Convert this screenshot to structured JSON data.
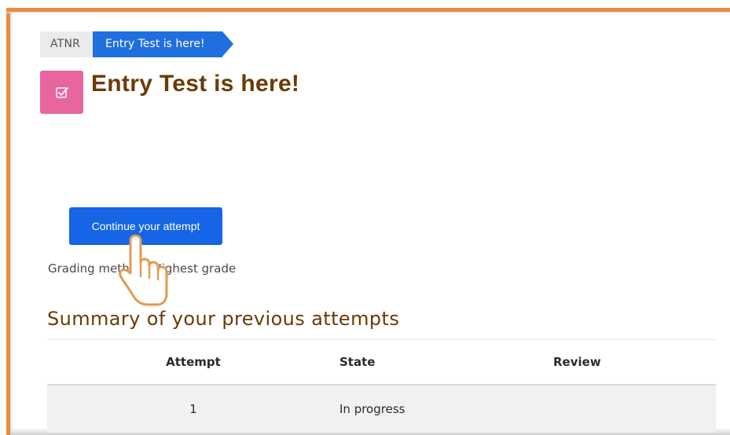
{
  "breadcrumb": {
    "root": "ATNR",
    "current": "Entry Test is here!"
  },
  "page": {
    "title": "Entry Test is here!",
    "icon": "quiz-checkbox-icon",
    "icon_color": "#e8659f",
    "title_color": "#6b3a06"
  },
  "actions": {
    "continue_label": "Continue your attempt",
    "button_color": "#1565e6"
  },
  "grading": {
    "label": "Grading method:",
    "value": "Highest grade"
  },
  "summary": {
    "title": "Summary of your previous attempts",
    "headers": [
      "Attempt",
      "State",
      "Review"
    ],
    "rows": [
      {
        "attempt": "1",
        "state": "In progress",
        "review": ""
      }
    ]
  },
  "cursor": "hand-pointer-icon"
}
